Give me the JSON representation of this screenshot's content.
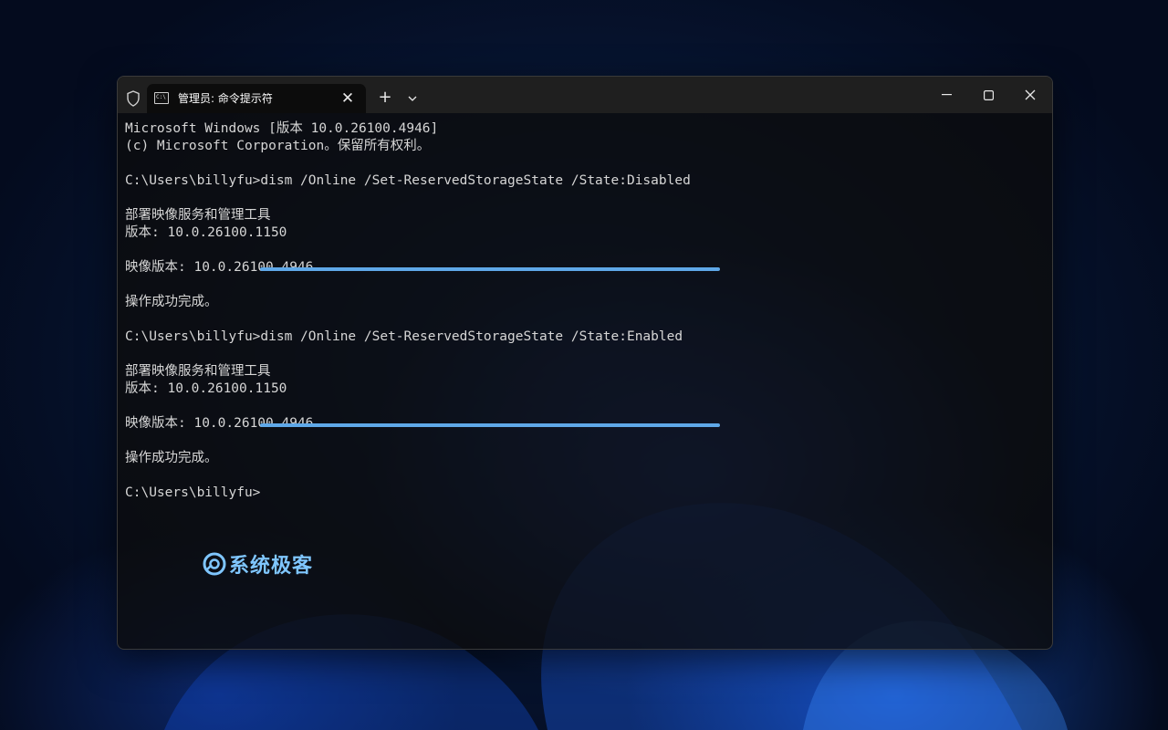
{
  "window": {
    "tab_title": "管理员: 命令提示符",
    "icons": {
      "shield": "shield-icon",
      "tab": "command-prompt-icon",
      "tab_close": "close-icon",
      "new_tab": "plus-icon",
      "dropdown": "chevron-down-icon",
      "minimize": "minimize-icon",
      "maximize": "maximize-icon",
      "close": "close-icon"
    }
  },
  "console": {
    "lines": [
      "Microsoft Windows [版本 10.0.26100.4946]",
      "(c) Microsoft Corporation。保留所有权利。",
      "",
      "C:\\Users\\billyfu>dism /Online /Set-ReservedStorageState /State:Disabled",
      "",
      "部署映像服务和管理工具",
      "版本: 10.0.26100.1150",
      "",
      "映像版本: 10.0.26100.4946",
      "",
      "操作成功完成。",
      "",
      "C:\\Users\\billyfu>dism /Online /Set-ReservedStorageState /State:Enabled",
      "",
      "部署映像服务和管理工具",
      "版本: 10.0.26100.1150",
      "",
      "映像版本: 10.0.26100.4946",
      "",
      "操作成功完成。",
      "",
      "C:\\Users\\billyfu>"
    ]
  },
  "highlight_color": "#5fa8e8",
  "watermark": {
    "text": "系统极客",
    "color": "#7fc6ff"
  }
}
